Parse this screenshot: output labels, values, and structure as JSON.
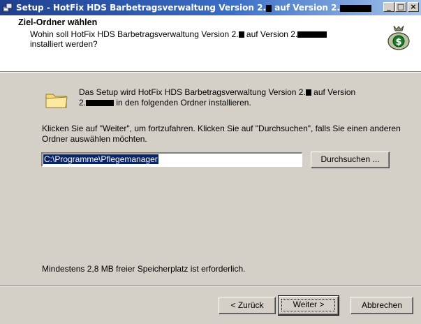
{
  "titlebar": {
    "title_prefix": "Setup - HotFix HDS Barbetragsverwaltung Version 2.",
    "title_middle": " auf Version 2.",
    "minimize_label": "_",
    "maximize_label": "□",
    "close_label": "×"
  },
  "header": {
    "title": "Ziel-Ordner wählen",
    "subtitle_line1_prefix": "Wohin soll HotFix HDS Barbetragsverwaltung Version 2.",
    "subtitle_line1_middle": " auf Version 2.",
    "subtitle_line2": "installiert werden?",
    "icon": "money-bag-icon"
  },
  "body": {
    "folder_icon": "folder-icon",
    "intro_prefix": "Das Setup wird HotFix HDS Barbetragsverwaltung Version 2.",
    "intro_middle": " auf Version",
    "intro_line2_prefix": "2.",
    "intro_line2_suffix": " in den folgenden Ordner installieren.",
    "hint": "Klicken Sie auf \"Weiter\", um fortzufahren. Klicken Sie auf \"Durchsuchen\", falls Sie einen anderen Ordner auswählen möchten.",
    "path_value": "C:\\Programme\\Pflegemanager",
    "browse_label": "Durchsuchen ...",
    "space_text": "Mindestens 2,8 MB freier Speicherplatz ist erforderlich."
  },
  "footer": {
    "back_label": "< Zurück",
    "next_label": "Weiter >",
    "cancel_label": "Abbrechen"
  },
  "colors": {
    "titlebar_start": "#1f3f8f",
    "titlebar_end": "#a6c4ea",
    "dialog_bg": "#d4d0c8",
    "selection": "#0a246a"
  }
}
